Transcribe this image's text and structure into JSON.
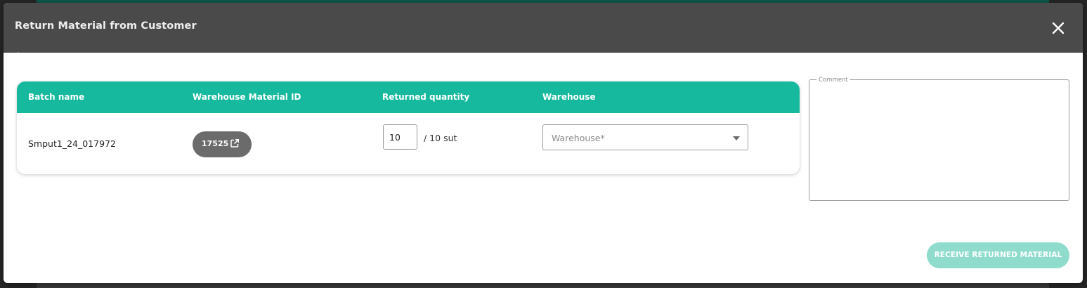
{
  "dialog": {
    "title": "Return Material from Customer",
    "close_icon": "close-icon",
    "top_mark": "¨"
  },
  "table": {
    "columns": [
      "Batch name",
      "Warehouse Material ID",
      "Returned quantity",
      "Warehouse"
    ],
    "rows": [
      {
        "batch_name": "Smput1_24_017972",
        "warehouse_material_id": "17525",
        "warehouse_material_id_icon": "external-link-icon",
        "returned_quantity": "10",
        "returned_quantity_total": "/ 10 sut",
        "warehouse_placeholder": "Warehouse*",
        "warehouse_icon": "caret-down-icon"
      }
    ]
  },
  "comment": {
    "label": "Comment",
    "value": ""
  },
  "actions": {
    "submit_label": "RECEIVE RETURNED MATERIAL",
    "submit_enabled": false
  },
  "colors": {
    "header_bg": "#4a4a4a",
    "table_header_bg": "#17b99e",
    "chip_bg": "#6b6b6b",
    "button_disabled_bg": "#8fdccd"
  }
}
